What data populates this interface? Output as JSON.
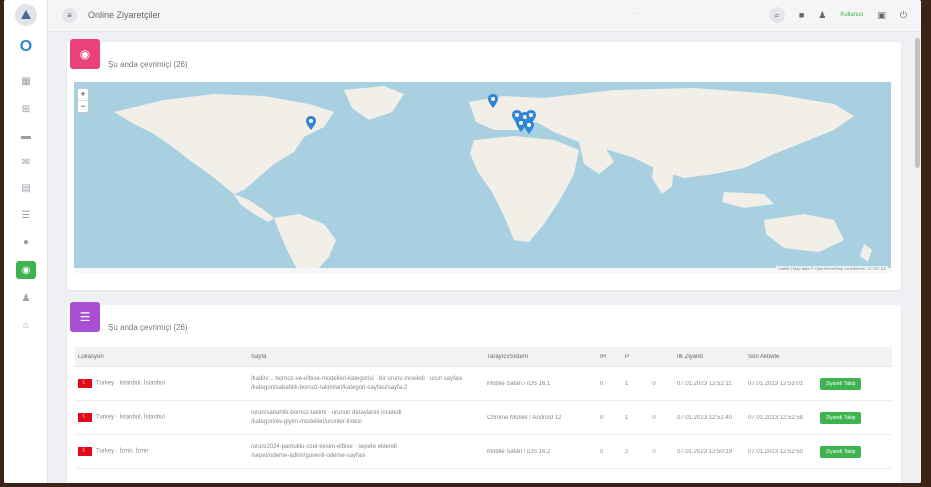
{
  "header": {
    "title": "Online Ziyaretçiler",
    "center_text": "···",
    "user_label": "Kullanıcı"
  },
  "map_card": {
    "title": "Şu anda çevrimiçi (26)",
    "attribution": "Leaflet | Map data © OpenStreetMap contributors, CC-BY-SA",
    "zoom_in": "+",
    "zoom_out": "−"
  },
  "table_card": {
    "title": "Şu anda çevrimiçi (26)",
    "columns": [
      "Lokasyon",
      "Sayfa",
      "Tarayıcı/Sistem",
      "IH",
      "P",
      "",
      "İlk Ziyaret",
      "Son Aktivite",
      ""
    ],
    "rows": [
      {
        "location": "Turkey · Istanbul, İstanbul",
        "page": "/kadin/... bornoz-ve-elbise-modelleri-kategorisi · bir urunu inceledi · urun sayfasi",
        "page2": "/kategori/sabahlik-bornoz-takimlari/kategori-sayfasi/sayfa-2",
        "browser": "Mobile Safari / iOS 16.1",
        "ih": "0",
        "p": "1",
        "x": "0",
        "first": "07.01.2023 12:52:11",
        "last": "07.01.2023 12:53:01",
        "action": "Ziyareti Takip"
      },
      {
        "location": "Turkey · Istanbul, İstanbul",
        "page": "/urun/sabahlik-bornoz-takimi · urunun detaylarini inceledi",
        "page2": "/kategori/ev-giyim-modelleri/urunler-listesi",
        "browser": "Chrome Mobile / Android 12",
        "ih": "0",
        "p": "1",
        "x": "0",
        "first": "07.01.2023 12:51:40",
        "last": "07.01.2023 12:52:58",
        "action": "Ziyareti Takip"
      },
      {
        "location": "Turkey · İzmir, İzmir",
        "page": "/urun/2024-pamuklu-ozel-kesim-elbise · sepete eklendi",
        "page2": "/sepet/odeme-adimi/guvenli-odeme-sayfasi",
        "browser": "Mobile Safari / iOS 16.2",
        "ih": "0",
        "p": "2",
        "x": "0",
        "first": "07.01.2023 12:50:19",
        "last": "07.01.2023 12:52:50",
        "action": "Ziyareti Takip"
      }
    ]
  }
}
